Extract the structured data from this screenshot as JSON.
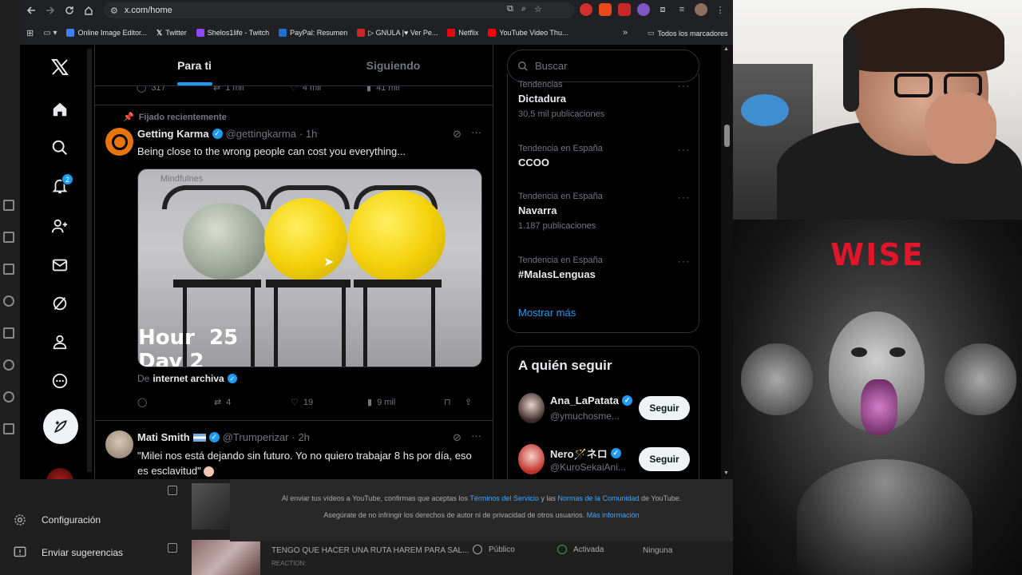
{
  "browser": {
    "url": "x.com/home",
    "bookmarks": [
      {
        "label": "Online Image Editor...",
        "color": "#3b82f6"
      },
      {
        "label": "Twitter",
        "color": "#ffffff"
      },
      {
        "label": "Shelos1life - Twitch",
        "color": "#9146ff"
      },
      {
        "label": "PayPal: Resumen",
        "color": "#1f6fd1"
      },
      {
        "label": "▷ GNULA |♥ Ver Pe...",
        "color": "#c62828"
      },
      {
        "label": "Netflix",
        "color": "#e50914"
      },
      {
        "label": "YouTube Video Thu...",
        "color": "#ff0000"
      }
    ],
    "all_bookmarks": "Todos los marcadores",
    "overflow": "»"
  },
  "x": {
    "notification_count": "2",
    "tabs": [
      {
        "label": "Para ti"
      },
      {
        "label": "Siguiendo"
      }
    ],
    "top_actions": {
      "replies": "317",
      "reposts": "1 mil",
      "likes": "4 mil",
      "views": "41 mil"
    },
    "pinned_label": "Fijado recientemente",
    "tweet1": {
      "name": "Getting Karma",
      "handle": "@gettingkarma",
      "time": "· 1h",
      "text": "Being close to the wrong people can cost you everything...",
      "media_watermark": "Mindfulnes",
      "media_caption_1": "Hour  25",
      "media_caption_2": "Day 2",
      "from_prefix": "De",
      "from_source": "internet archiva",
      "reposts": "4",
      "likes": "19",
      "views": "9 mil"
    },
    "tweet2": {
      "name": "Mati Smith",
      "handle": "@Trumperizar",
      "time": "· 2h",
      "text": "\"Milei nos está dejando sin futuro. Yo no quiero trabajar 8 hs por día, eso es esclavitud\""
    },
    "search_placeholder": "Buscar",
    "trends": [
      {
        "category": "Tendencias",
        "name": "Dictadura",
        "count": "30,5 mil publicaciones"
      },
      {
        "category": "Tendencia en España",
        "name": "CCOO",
        "count": ""
      },
      {
        "category": "Tendencia en España",
        "name": "Navarra",
        "count": "1.187 publicaciones"
      },
      {
        "category": "Tendencia en España",
        "name": "#MalasLenguas",
        "count": ""
      }
    ],
    "show_more": "Mostrar más",
    "who_to_follow_title": "A quién seguir",
    "follow_suggestions": [
      {
        "name": "Ana_LaPatata",
        "handle": "@ymuchosme...",
        "button": "Seguir"
      },
      {
        "name": "Nero🪄ネロ",
        "handle": "@KuroSekaiAni...",
        "button": "Seguir"
      }
    ],
    "colors": {
      "accent": "#1d9bf0",
      "background": "#000000",
      "border": "#2f3336",
      "muted": "#71767b"
    }
  },
  "youtube": {
    "sidebar": [
      {
        "label": "Configuración"
      },
      {
        "label": "Enviar sugerencias"
      }
    ],
    "notice_line1_a": "Al enviar tus vídeos a YouTube, confirmas que aceptas los",
    "notice_terms": "Términos del Servicio",
    "notice_line1_b": "y las",
    "notice_community": "Normas de la Comunidad",
    "notice_line1_c": "de YouTube.",
    "notice_line2": "Asegúrate de no infringir los derechos de autor ni de privacidad de otros usuarios.",
    "notice_more": "Más información",
    "row": {
      "title": "TENGO QUE HACER UNA RUTA HAREM PARA SAL...",
      "subtitle": "REACTION:",
      "visibility": "Público",
      "monetization": "Activada",
      "restrictions": "Ninguna"
    }
  },
  "overlay": {
    "wise_text": "WISE"
  }
}
